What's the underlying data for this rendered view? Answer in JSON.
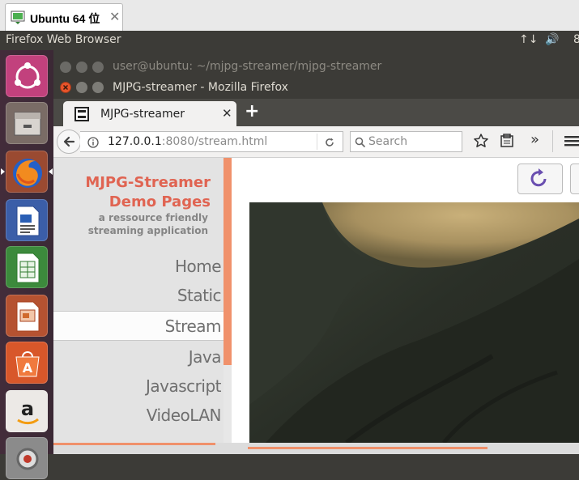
{
  "vm_tab": {
    "title": "Ubuntu 64 位",
    "close": "✕"
  },
  "topbar": {
    "title": "Firefox Web Browser",
    "network_icon": "↑↓",
    "volume_icon": "🔊",
    "extra": "8"
  },
  "launcher": {
    "items": [
      "ubuntu-dash",
      "files",
      "firefox",
      "libreoffice-writer",
      "libreoffice-calc",
      "libreoffice-impress",
      "ubuntu-software-center",
      "amazon",
      "system-settings"
    ]
  },
  "terminal_window": {
    "title": "user@ubuntu: ~/mjpg-streamer/mjpg-streamer"
  },
  "firefox_window": {
    "title": "MJPG-streamer - Mozilla Firefox"
  },
  "tabs": [
    {
      "title": "MJPG-streamer",
      "close": "✕"
    }
  ],
  "newtab_label": "+",
  "navbar": {
    "url_host": "127.0.0.1",
    "url_rest": ":8080/stream.html",
    "search_placeholder": "Search",
    "overflow": "»"
  },
  "page": {
    "brand_line1": "MJPG-Streamer",
    "brand_line2": "Demo Pages",
    "tagline1": "a ressource friendly",
    "tagline2": "streaming application",
    "nav": [
      "Home",
      "Static",
      "Stream",
      "Java",
      "Javascript",
      "VideoLAN"
    ],
    "active_nav": "Stream"
  },
  "colors": {
    "accent": "#e06452",
    "sidebar_border": "#f0916b",
    "launcher_bg": "#432c3a"
  }
}
